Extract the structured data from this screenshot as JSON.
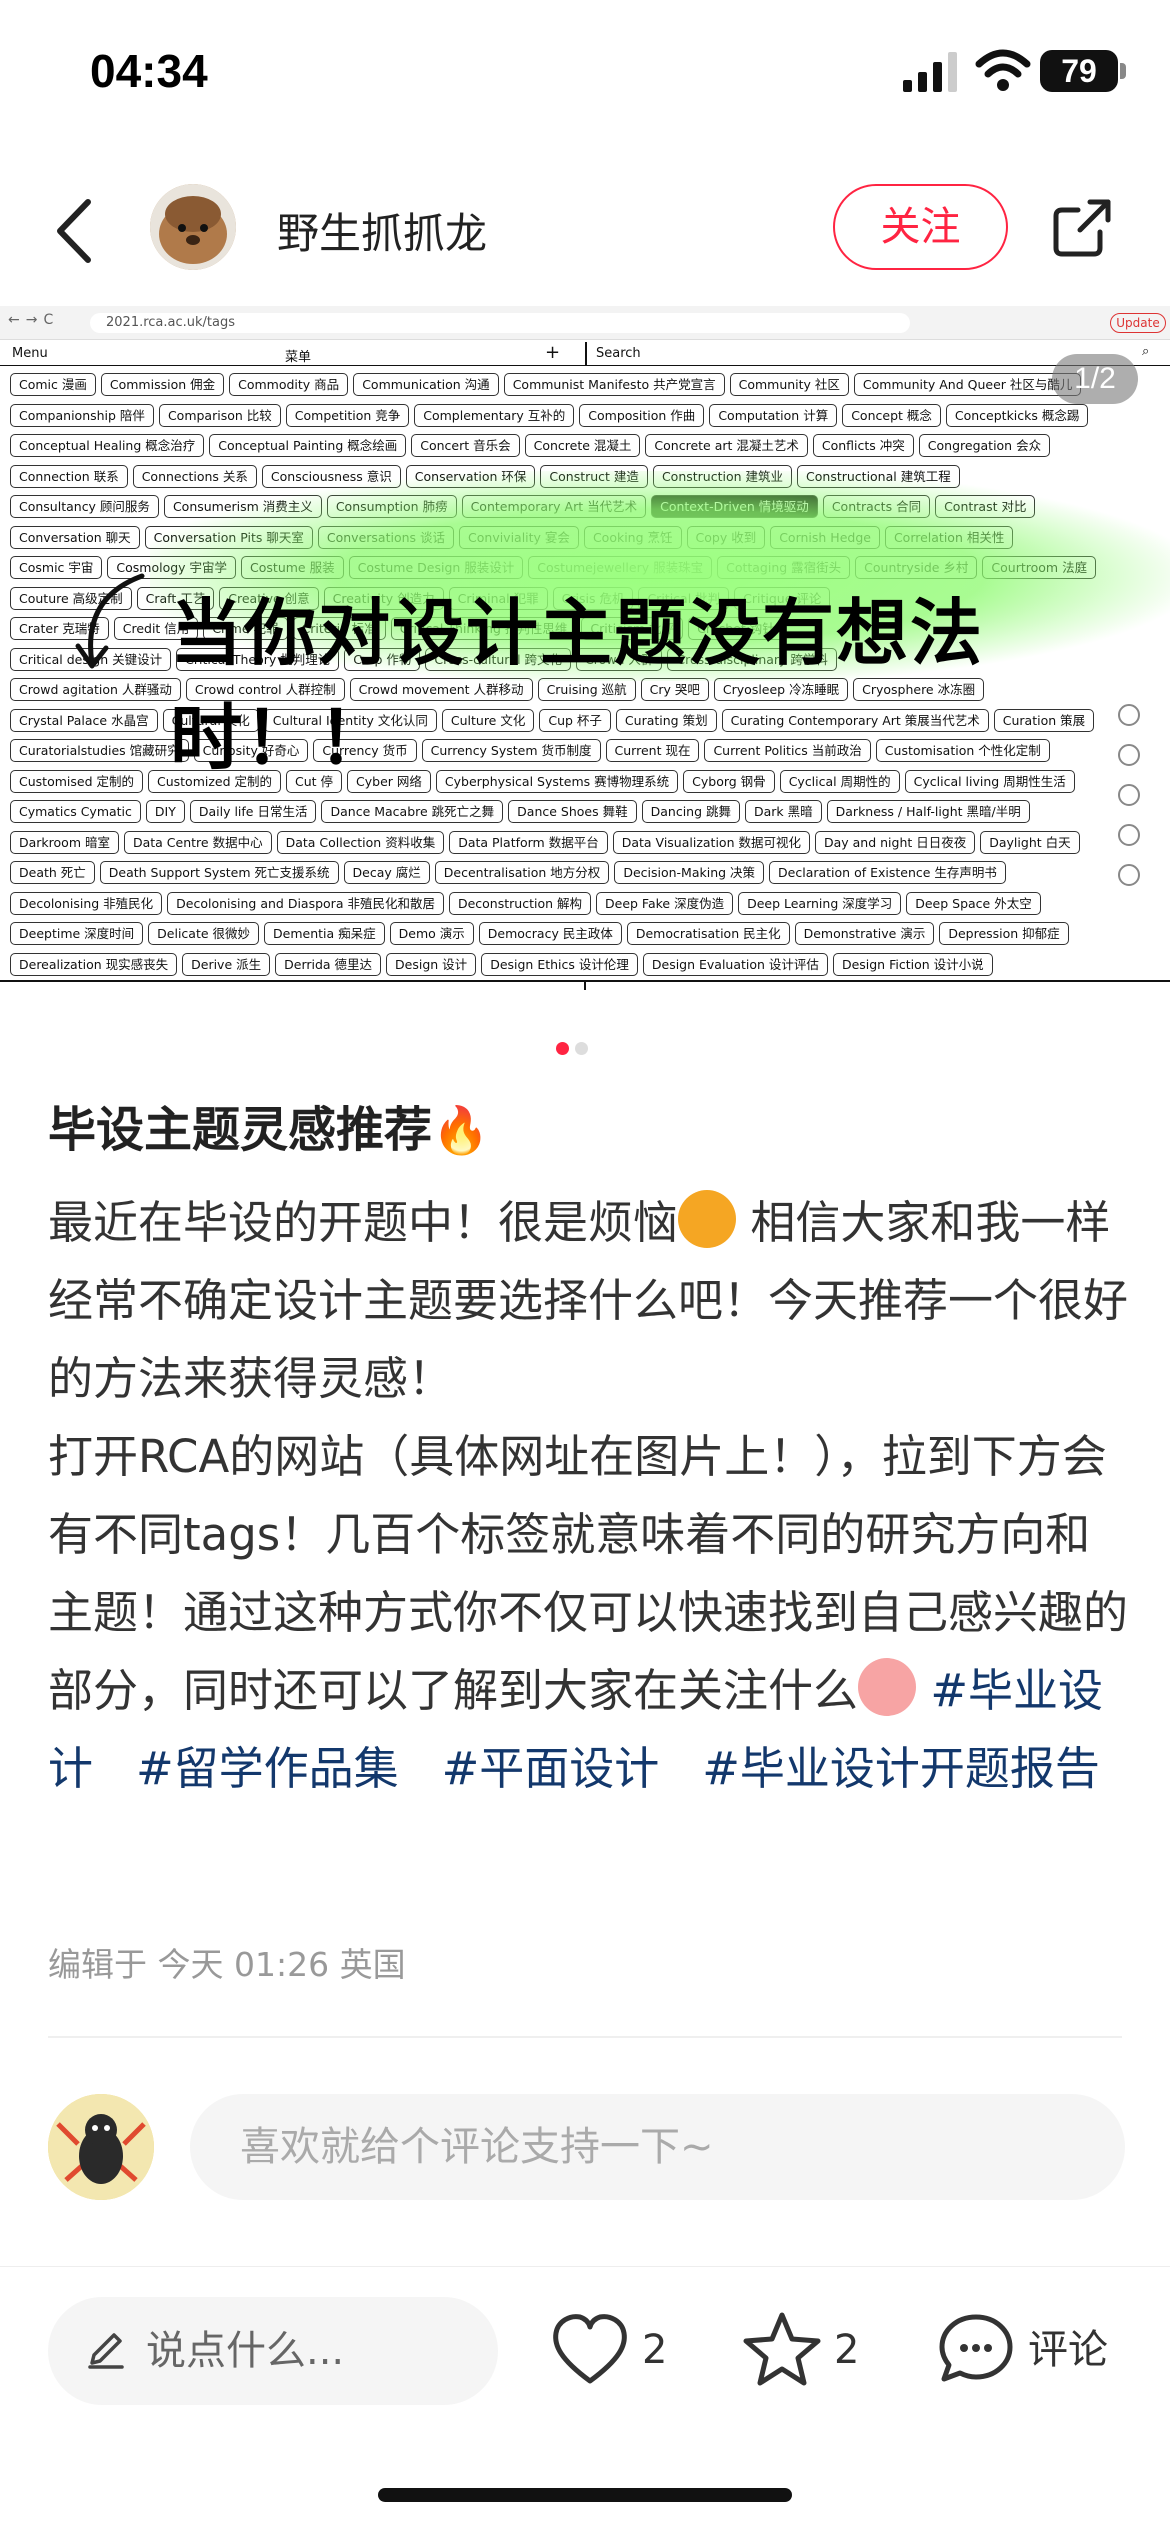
{
  "status_bar": {
    "time": "04:34",
    "battery": "79"
  },
  "author": {
    "name": "野生抓抓龙",
    "follow_label": "关注"
  },
  "image": {
    "pager": "1/2",
    "url": "2021.rca.ac.uk/tags",
    "update_label": "Update",
    "menu_label": "Menu",
    "menu_cn": "菜单",
    "search_label": "Search",
    "overlay_text": "当你对设计主题没有想法时！！",
    "tag_rows": [
      [
        "Comic 漫画",
        "Commission 佣金",
        "Commodity 商品",
        "Communication 沟通",
        "Communist Manifesto 共产党宣言",
        "Community 社区",
        "Community And Queer 社区与酷儿"
      ],
      [
        "Companionship 陪伴",
        "Comparison 比较",
        "Competition 竞争",
        "Complementary 互补的",
        "Composition 作曲",
        "Computation 计算",
        "Concept 概念",
        "Conceptkicks 概念踢"
      ],
      [
        "Conceptual Healing 概念治疗",
        "Conceptual Painting 概念绘画",
        "Concert 音乐会",
        "Concrete 混凝土",
        "Concrete art 混凝土艺术",
        "Conflicts 冲突",
        "Congregation 会众"
      ],
      [
        "Connection 联系",
        "Connections 关系",
        "Consciousness 意识",
        "Conservation 环保",
        "Construct 建造",
        "Construction 建筑业",
        "Constructional 建筑工程"
      ],
      [
        "Consultancy 顾问服务",
        "Consumerism 消费主义",
        "Consumption 肺痨",
        "Contemporary Art 当代艺术",
        "Context-Driven 情境驱动",
        "Contracts 合同",
        "Contrast 对比"
      ],
      [
        "Conversation 聊天",
        "Conversation Pits 聊天室",
        "Conversations 谈话",
        "Conviviality 宴会",
        "Cooking 烹饪",
        "Copy 收到",
        "Cornish Hedge",
        "Correlation 相关性"
      ],
      [
        "Cosmic 宇宙",
        "Cosmology 宇宙学",
        "Costume 服装",
        "Costume Design 服装设计",
        "Costumejewellery 服装珠宝",
        "Cottaging 露宿街头",
        "Countryside 乡村",
        "Courtroom 法庭"
      ],
      [
        "Couture 高级定制",
        "Craft 工艺",
        "Creative 创意",
        "Creativity 创造力",
        "Criminal 犯罪",
        "Crisis 危机",
        "Critical 批判",
        "Critique 评论"
      ],
      [
        "Crater 克瑞特",
        "Credit 信用",
        "Crime 犯罪",
        "Criteria 标准",
        "Critical Thinking 批判性思维",
        "Criticism 批评",
        "Crochet 钩针"
      ],
      [
        "Critical design 关键设计",
        "Critical Theory 批判理论",
        "Crop 作物",
        "Cross-cultural 跨文化",
        "Crowd 人群",
        "Cross-disciplinary 跨学科"
      ],
      [
        "Crowd agitation 人群骚动",
        "Crowd control 人群控制",
        "Crowd movement 人群移动",
        "Cruising 巡航",
        "Cry 哭吧",
        "Cryosleep 冷冻睡眠",
        "Cryosphere 冰冻圈"
      ],
      [
        "Crystal Palace 水晶宫",
        "Cultural 文化",
        "Cultural Identity 文化认同",
        "Culture 文化",
        "Cup 杯子",
        "Curating 策划",
        "Curating Contemporary Art 策展当代艺术",
        "Curation 策展"
      ],
      [
        "Curatorialstudies 馆藏研究",
        "Curiosity 好奇心",
        "Currency 货币",
        "Currency System 货币制度",
        "Current 现在",
        "Current Politics 当前政治",
        "Customisation 个性化定制"
      ],
      [
        "Customised 定制的",
        "Customized 定制的",
        "Cut 停",
        "Cyber 网络",
        "Cyberphysical Systems 赛博物理系统",
        "Cyborg 钢骨",
        "Cyclical 周期性的",
        "Cyclical living 周期性生活"
      ],
      [
        "Cymatics Cymatic",
        "DIY",
        "Daily life 日常生活",
        "Dance Macabre 跳死亡之舞",
        "Dance Shoes 舞鞋",
        "Dancing 跳舞",
        "Dark 黑暗",
        "Darkness / Half-light 黑暗/半明"
      ],
      [
        "Darkroom 暗室",
        "Data Centre 数据中心",
        "Data Collection 资料收集",
        "Data Platform 数据平台",
        "Data Visualization 数据可视化",
        "Day and night 日日夜夜",
        "Daylight 白天"
      ],
      [
        "Death 死亡",
        "Death Support System 死亡支援系统",
        "Decay 腐烂",
        "Decentralisation 地方分权",
        "Decision-Making 决策",
        "Declaration of Existence 生存声明书"
      ],
      [
        "Decolonising 非殖民化",
        "Decolonising and Diaspora 非殖民化和散居",
        "Deconstruction 解构",
        "Deep Fake 深度伪造",
        "Deep Learning 深度学习",
        "Deep Space 外太空"
      ],
      [
        "Deeptime 深度时间",
        "Delicate 很微妙",
        "Dementia 痴呆症",
        "Demo 演示",
        "Democracy 民主政体",
        "Democratisation 民主化",
        "Demonstrative 演示",
        "Depression 抑郁症"
      ],
      [
        "Derealization 现实感丧失",
        "Derive 派生",
        "Derrida 德里达",
        "Design 设计",
        "Design Ethics 设计伦理",
        "Design Evaluation 设计评估",
        "Design Fiction 设计小说"
      ]
    ]
  },
  "note": {
    "title": "毕设主题灵感推荐",
    "p1a": "最近在毕设的开题中！很是烦恼",
    "p1b": " 相信大家和我一样经常不确定设计主题要选择什么吧！今天推荐一个很好的方法来获得灵感！",
    "p2": "打开RCA的网站（具体网址在图片上！），拉到下方会有不同tags！几百个标签就意味着不同的研究方向和主题！通过这种方式你不仅可以快速找到自己感兴趣的部分，同时还可以了解到大家在关注什么",
    "hashtags": [
      "#毕业设计",
      "#留学作品集",
      "#平面设计",
      "#毕业设计开题报告"
    ],
    "edited": "编辑于 今天 01:26 英国"
  },
  "comment": {
    "placeholder": "喜欢就给个评论支持一下~"
  },
  "bottom_bar": {
    "say_label": "说点什么...",
    "likes": "2",
    "collects": "2",
    "comment_label": "评论"
  }
}
